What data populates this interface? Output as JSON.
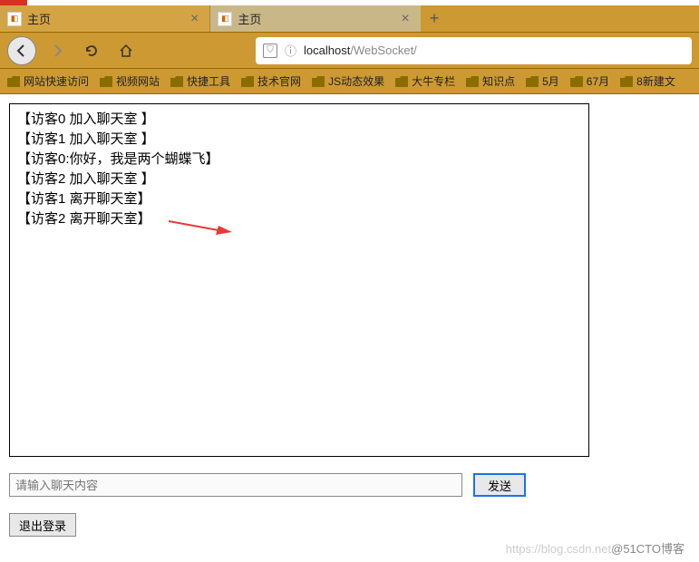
{
  "tabs": [
    {
      "title": "主页",
      "active": true
    },
    {
      "title": "主页",
      "active": false
    }
  ],
  "url": {
    "host": "localhost",
    "path": "/WebSocket/"
  },
  "bookmarks": [
    "网站快速访问",
    "视频网站",
    "快捷工具",
    "技术官网",
    "JS动态效果",
    "大牛专栏",
    "知识点",
    "5月",
    "67月",
    "8新建文"
  ],
  "chat": {
    "messages": [
      "【访客0 加入聊天室 】",
      "【访客1 加入聊天室 】",
      "【访客0:你好，我是两个蝴蝶飞】",
      "【访客2 加入聊天室 】",
      "【访客1 离开聊天室】",
      "【访客2 离开聊天室】"
    ],
    "placeholder": "请输入聊天内容",
    "send_label": "发送",
    "logout_label": "退出登录"
  },
  "watermark": {
    "light": "https://blog.csdn.net",
    "dark": "@51CTO博客"
  }
}
